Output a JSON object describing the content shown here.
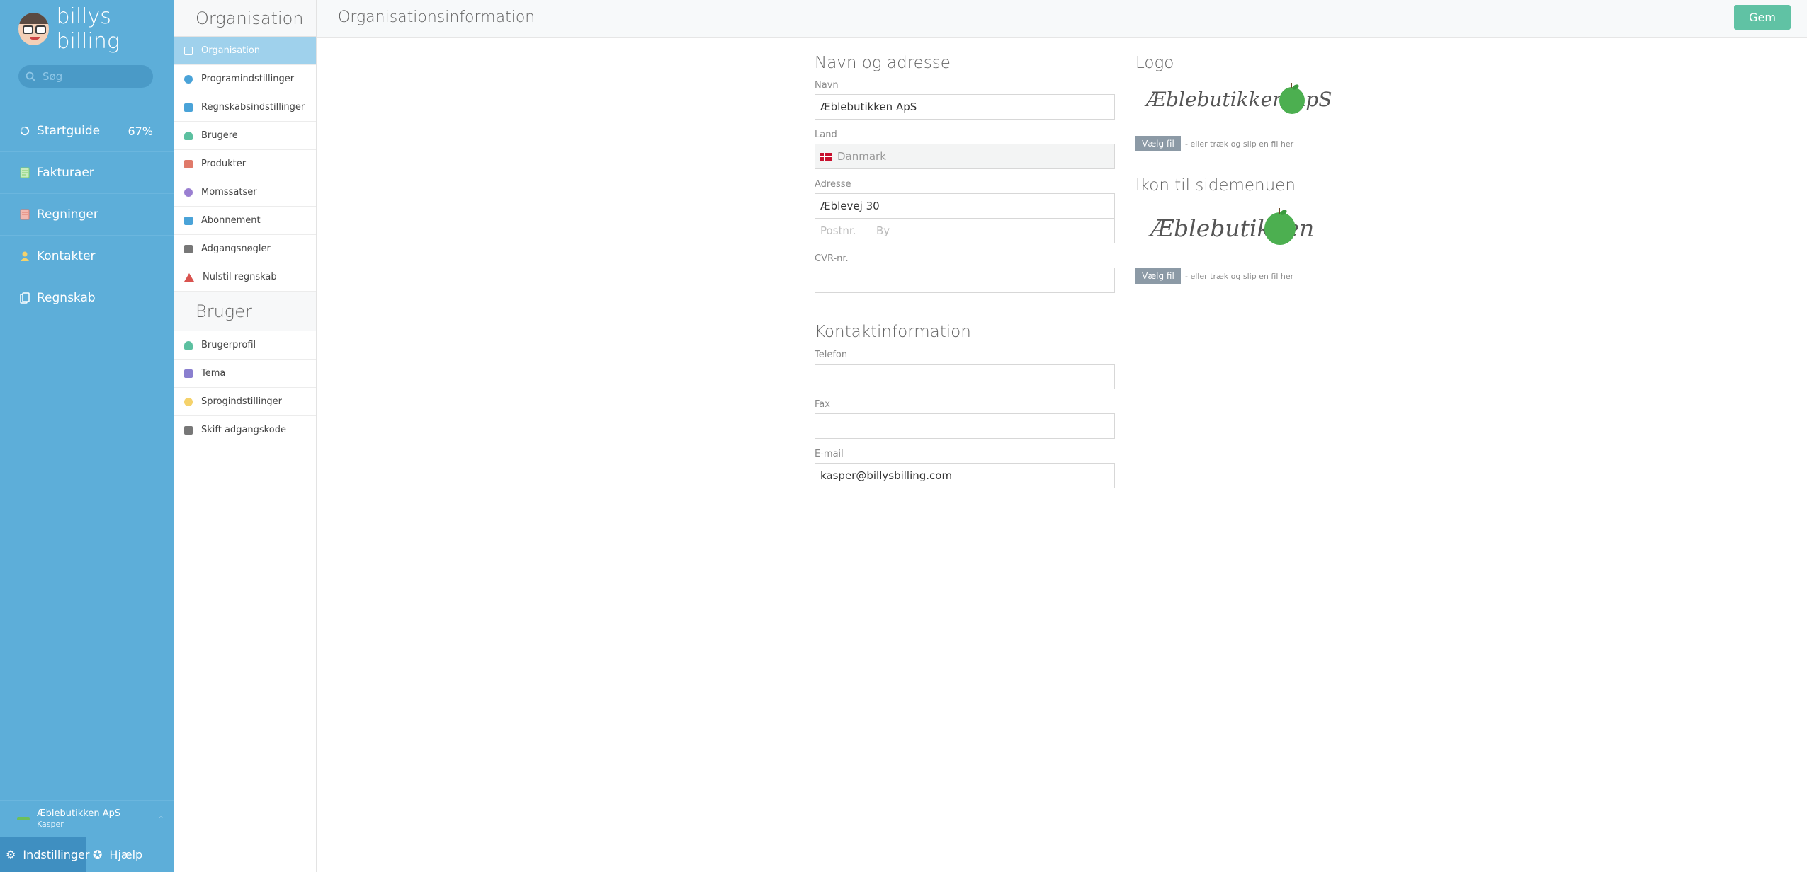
{
  "brand": {
    "name": "billys billing"
  },
  "search": {
    "placeholder": "Søg"
  },
  "main_nav": [
    {
      "label": "Startguide",
      "icon": "progress-ring-icon",
      "extra": "67%"
    },
    {
      "label": "Fakturaer",
      "icon": "invoice-icon",
      "extra": ""
    },
    {
      "label": "Regninger",
      "icon": "bill-icon",
      "extra": ""
    },
    {
      "label": "Kontakter",
      "icon": "contacts-icon",
      "extra": ""
    },
    {
      "label": "Regnskab",
      "icon": "ledger-icon",
      "extra": ""
    }
  ],
  "org_footer": {
    "org_name": "Æblebutikken ApS",
    "user": "Kasper"
  },
  "bottom_bar": {
    "settings": "Indstillinger",
    "help": "Hjælp"
  },
  "subnav": {
    "org_heading": "Organisation",
    "org_items": [
      {
        "label": "Organisation",
        "color": "#ffffff"
      },
      {
        "label": "Programindstillinger",
        "color": "#4aa3d8"
      },
      {
        "label": "Regnskabsindstillinger",
        "color": "#4aa3d8"
      },
      {
        "label": "Brugere",
        "color": "#5cc0a0"
      },
      {
        "label": "Produkter",
        "color": "#e07a6a"
      },
      {
        "label": "Momssatser",
        "color": "#9a7fd1"
      },
      {
        "label": "Abonnement",
        "color": "#4aa3d8"
      },
      {
        "label": "Adgangsnøgler",
        "color": "#777777"
      },
      {
        "label": "Nulstil regnskab",
        "color": "#d9534f"
      }
    ],
    "user_heading": "Bruger",
    "user_items": [
      {
        "label": "Brugerprofil",
        "color": "#5cc0a0"
      },
      {
        "label": "Tema",
        "color": "#8a7fcf"
      },
      {
        "label": "Sprogindstillinger",
        "color": "#f5d26b"
      },
      {
        "label": "Skift adgangskode",
        "color": "#777777"
      }
    ]
  },
  "header": {
    "title": "Organisationsinformation",
    "save": "Gem"
  },
  "name_address": {
    "title": "Navn og adresse",
    "name_label": "Navn",
    "name_value": "Æblebutikken ApS",
    "country_label": "Land",
    "country_value": "Danmark",
    "address_label": "Adresse",
    "street_value": "Æblevej 30",
    "zip_placeholder": "Postnr.",
    "city_placeholder": "By",
    "cvr_label": "CVR-nr.",
    "cvr_value": ""
  },
  "contact": {
    "title": "Kontaktinformation",
    "phone_label": "Telefon",
    "phone_value": "",
    "fax_label": "Fax",
    "fax_value": "",
    "email_label": "E-mail",
    "email_value": "kasper@billysbilling.com"
  },
  "logo": {
    "title": "Logo",
    "logo_text": "Æblebutikken ApS",
    "choose": "Vælg fil",
    "hint": "- eller træk og slip en fil her"
  },
  "icon_section": {
    "title": "Ikon til sidemenuen",
    "icon_text": "Æblebutikken",
    "choose": "Vælg fil",
    "hint": "- eller træk og slip en fil her"
  }
}
